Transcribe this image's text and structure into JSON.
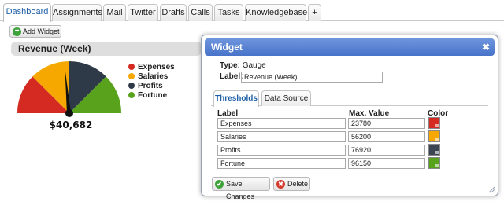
{
  "tabs": [
    {
      "label": "Dashboard",
      "active": true
    },
    {
      "label": "Assignments"
    },
    {
      "label": "Mail"
    },
    {
      "label": "Twitter"
    },
    {
      "label": "Drafts"
    },
    {
      "label": "Calls"
    },
    {
      "label": "Tasks"
    },
    {
      "label": "Knowledgebase"
    },
    {
      "label": "+"
    }
  ],
  "toolbar": {
    "add_widget_label": "Add Widget",
    "add_icon": "plus-circle-icon"
  },
  "gauge_widget": {
    "title": "Revenue (Week)",
    "value_label": "$40,682",
    "legend": [
      {
        "label": "Expenses",
        "color": "#d42a21"
      },
      {
        "label": "Salaries",
        "color": "#f6a800"
      },
      {
        "label": "Profits",
        "color": "#2f3a48"
      },
      {
        "label": "Fortune",
        "color": "#58a21c"
      }
    ],
    "needle_color": "#111111"
  },
  "dialog": {
    "title": "Widget",
    "close_glyph": "✖",
    "type_label": "Type:",
    "type_value": "Gauge",
    "label_label": "Label:",
    "label_value": "Revenue (Week)",
    "tabs": [
      {
        "label": "Thresholds",
        "active": true
      },
      {
        "label": "Data Source"
      }
    ],
    "columns": {
      "label": "Label",
      "max": "Max. Value",
      "color": "Color"
    },
    "rows": [
      {
        "label": "Expenses",
        "max": "23780",
        "color": "#d42a21"
      },
      {
        "label": "Salaries",
        "max": "56200",
        "color": "#f6a800"
      },
      {
        "label": "Profits",
        "max": "76920",
        "color": "#3c4652"
      },
      {
        "label": "Fortune",
        "max": "96150",
        "color": "#58a21c"
      }
    ],
    "save_label": "Save Changes",
    "delete_label": "Delete",
    "save_icon_color": "#3da23a",
    "delete_icon_color": "#d43a2e"
  }
}
